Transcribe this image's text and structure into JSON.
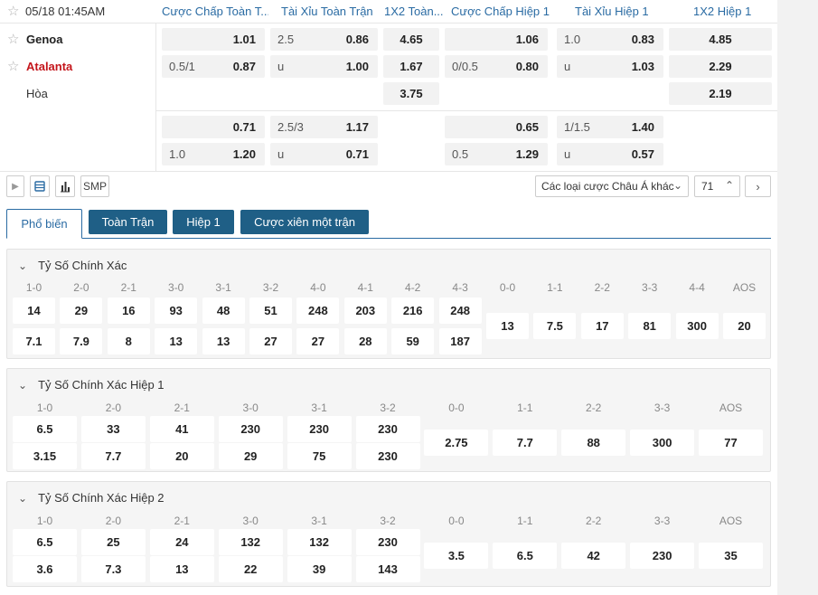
{
  "match": {
    "time": "05/18 01:45AM",
    "columns": [
      "Cược Chấp Toàn T...",
      "Tài Xỉu Toàn Trận",
      "1X2 Toàn...",
      "Cược Chấp Hiệp 1",
      "Tài Xỉu Hiệp 1",
      "1X2 Hiệp 1"
    ],
    "home": "Genoa",
    "away": "Atalanta",
    "draw": "Hòa",
    "main": {
      "hc_full": [
        {
          "line": "",
          "odds": "1.01"
        },
        {
          "line": "0.5/1",
          "odds": "0.87"
        }
      ],
      "ou_full": [
        {
          "line": "2.5",
          "odds": "0.86"
        },
        {
          "line": "u",
          "odds": "1.00"
        }
      ],
      "x12_full": [
        "4.65",
        "1.67",
        "3.75"
      ],
      "hc_h1": [
        {
          "line": "",
          "odds": "1.06"
        },
        {
          "line": "0/0.5",
          "odds": "0.80"
        }
      ],
      "ou_h1": [
        {
          "line": "1.0",
          "odds": "0.83"
        },
        {
          "line": "u",
          "odds": "1.03"
        }
      ],
      "x12_h1": [
        "4.85",
        "2.29",
        "2.19"
      ]
    },
    "alt": {
      "hc_full": [
        {
          "line": "",
          "odds": "0.71"
        },
        {
          "line": "1.0",
          "odds": "1.20"
        }
      ],
      "ou_full": [
        {
          "line": "2.5/3",
          "odds": "1.17"
        },
        {
          "line": "u",
          "odds": "0.71"
        }
      ],
      "hc_h1": [
        {
          "line": "",
          "odds": "0.65"
        },
        {
          "line": "0.5",
          "odds": "1.29"
        }
      ],
      "ou_h1": [
        {
          "line": "1/1.5",
          "odds": "1.40"
        },
        {
          "line": "u",
          "odds": "0.57"
        }
      ]
    }
  },
  "toolbar": {
    "play_icon": "play-icon",
    "smp_label": "SMP",
    "dropdown_label": "Các loại cược Châu Á khác",
    "count": "71"
  },
  "tabs": [
    "Phổ biến",
    "Toàn Trận",
    "Hiệp 1",
    "Cược xiên một trận"
  ],
  "panels": [
    {
      "title": "Tỷ Số Chính Xác",
      "scores": [
        "1-0",
        "2-0",
        "2-1",
        "3-0",
        "3-1",
        "3-2",
        "4-0",
        "4-1",
        "4-2",
        "4-3",
        "0-0",
        "1-1",
        "2-2",
        "3-3",
        "4-4",
        "AOS"
      ],
      "row1": [
        "14",
        "29",
        "16",
        "93",
        "48",
        "51",
        "248",
        "203",
        "216",
        "248"
      ],
      "row2": [
        "7.1",
        "7.9",
        "8",
        "13",
        "13",
        "27",
        "27",
        "28",
        "59",
        "187"
      ],
      "single": [
        "13",
        "7.5",
        "17",
        "81",
        "300",
        "20"
      ]
    },
    {
      "title": "Tỷ Số Chính Xác Hiệp 1",
      "scores": [
        "1-0",
        "2-0",
        "2-1",
        "3-0",
        "3-1",
        "3-2",
        "0-0",
        "1-1",
        "2-2",
        "3-3",
        "AOS"
      ],
      "row1": [
        "6.5",
        "33",
        "41",
        "230",
        "230",
        "230"
      ],
      "row2": [
        "3.15",
        "7.7",
        "20",
        "29",
        "75",
        "230"
      ],
      "single": [
        "2.75",
        "7.7",
        "88",
        "300",
        "77"
      ]
    },
    {
      "title": "Tỷ Số Chính Xác Hiệp 2",
      "scores": [
        "1-0",
        "2-0",
        "2-1",
        "3-0",
        "3-1",
        "3-2",
        "0-0",
        "1-1",
        "2-2",
        "3-3",
        "AOS"
      ],
      "row1": [
        "6.5",
        "25",
        "24",
        "132",
        "132",
        "230"
      ],
      "row2": [
        "3.6",
        "7.3",
        "13",
        "22",
        "39",
        "143"
      ],
      "single": [
        "3.5",
        "6.5",
        "42",
        "230",
        "35"
      ]
    }
  ]
}
